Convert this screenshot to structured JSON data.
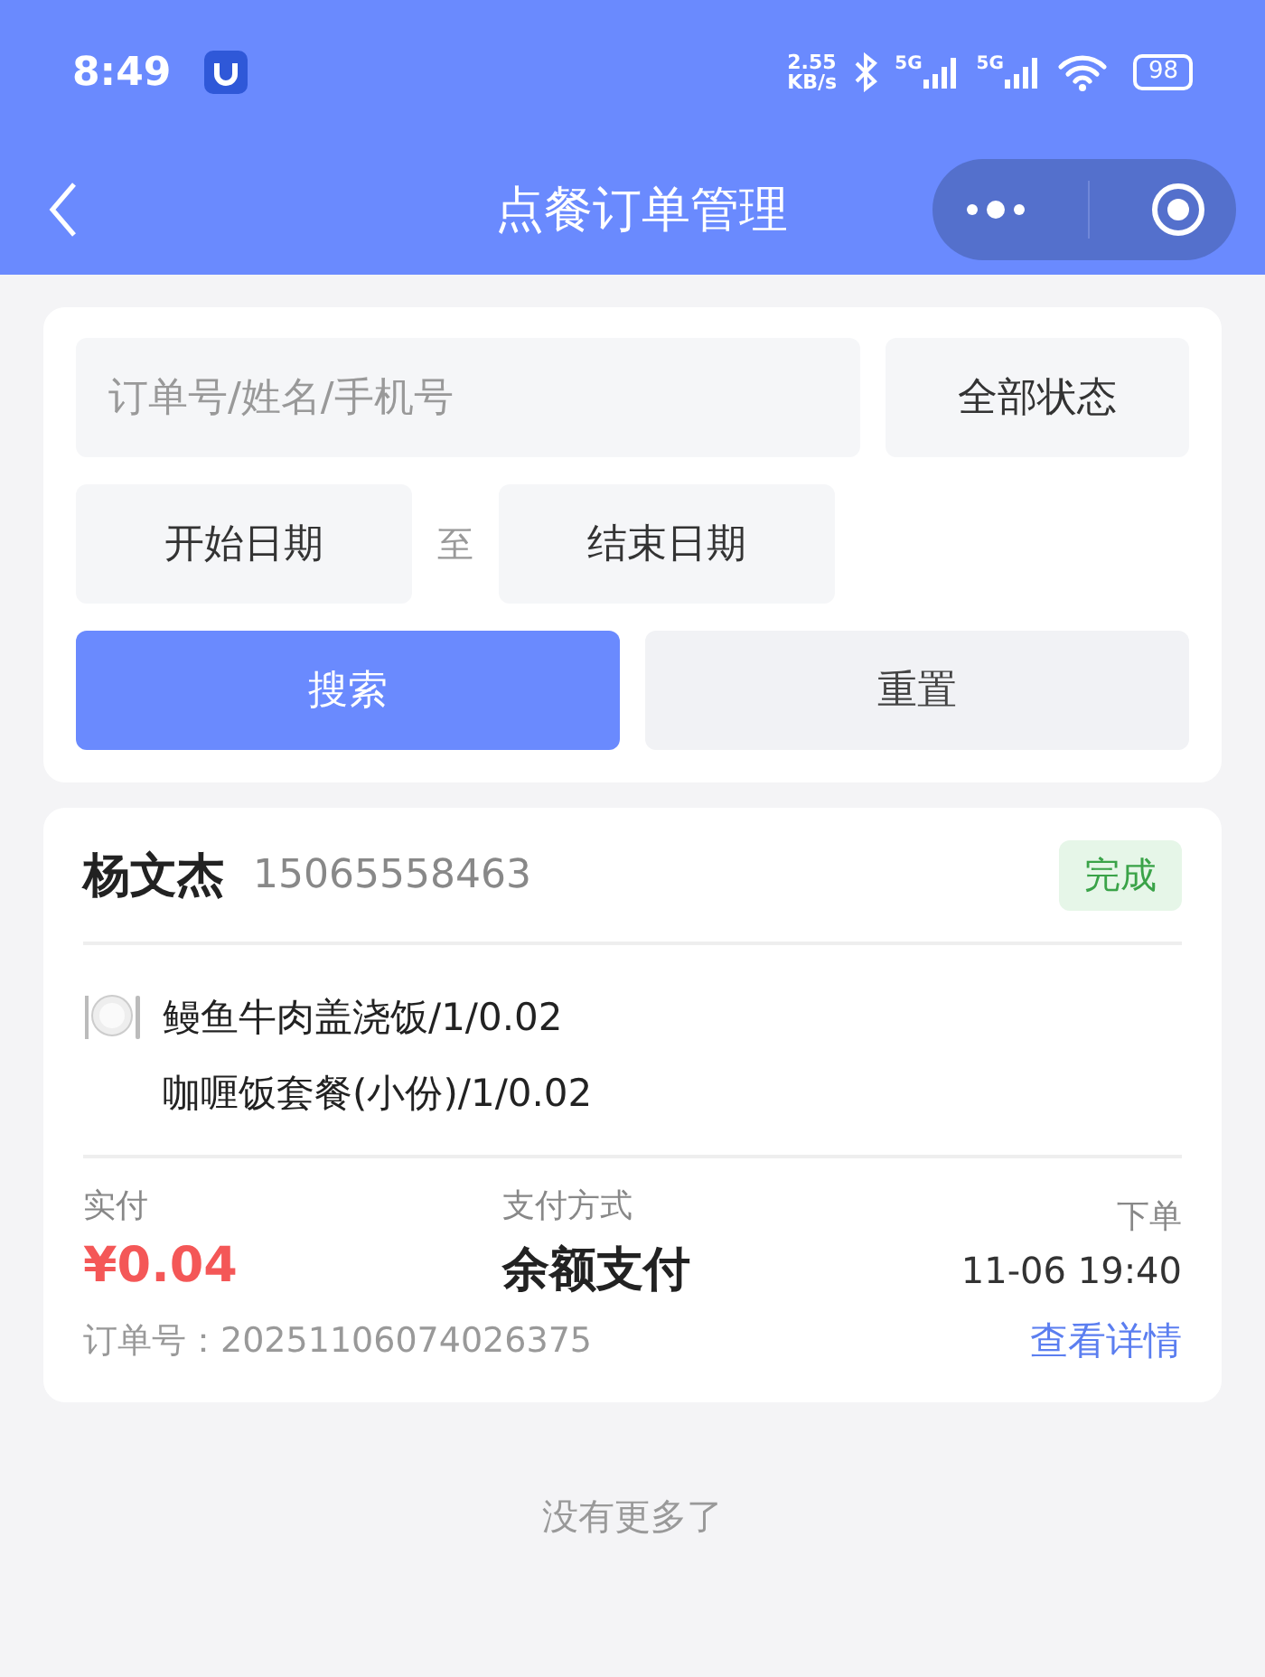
{
  "status_bar": {
    "time": "8:49",
    "speed_value": "2.55",
    "speed_unit": "KB/s",
    "network_labels": [
      "5G",
      "5G"
    ],
    "battery": "98"
  },
  "nav": {
    "title": "点餐订单管理"
  },
  "filters": {
    "keyword": {
      "placeholder": "订单号/姓名/手机号"
    },
    "status_select": "全部状态",
    "start_date": {
      "placeholder": "开始日期"
    },
    "separator": "至",
    "end_date": {
      "placeholder": "结束日期"
    },
    "search_button": "搜索",
    "reset_button": "重置"
  },
  "orders": [
    {
      "name": "杨文杰",
      "phone": "15065558463",
      "status": "完成",
      "items": [
        "鳗鱼牛肉盖浇饭/1/0.02",
        "咖喱饭套餐(小份)/1/0.02"
      ],
      "paid_label": "实付",
      "paid": "¥0.04",
      "method_label": "支付方式",
      "method": "余额支付",
      "time_label": "下单",
      "time": "11-06 19:40",
      "order_no": "订单号：20251106074026375",
      "detail_link": "查看详情"
    }
  ],
  "footer": "没有更多了"
}
